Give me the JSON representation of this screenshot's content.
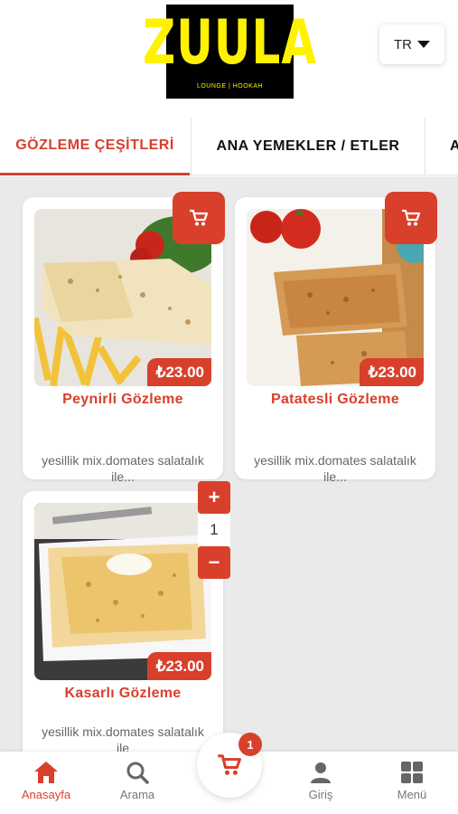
{
  "header": {
    "logo_text": "ZUULA",
    "logo_subtitle": "LOUNGE | HOOKAH",
    "language": "TR"
  },
  "tabs": [
    {
      "label": "GÖZLEME ÇEŞİTLERİ",
      "active": true
    },
    {
      "label": "ANA YEMEKLER / ETLER",
      "active": false
    },
    {
      "label": "A",
      "active": false
    }
  ],
  "products": [
    {
      "name": "Peynirli Gözleme",
      "price": "₺23.00",
      "description": "yesillik mix.domates salatalık ile...",
      "image_icon": "gozleme-fries-plate"
    },
    {
      "name": "Patatesli Gözleme",
      "price": "₺23.00",
      "description": "yesillik mix.domates salatalık ile...",
      "image_icon": "gozleme-board"
    },
    {
      "name": "Kasarlı Gözleme",
      "price": "₺23.00",
      "description": "yesillik mix.domates salatalık ile",
      "image_icon": "gozleme-cheese-plate",
      "quantity": "1"
    }
  ],
  "stepper": {
    "plus": "+",
    "minus": "−"
  },
  "bottom_nav": {
    "items": [
      {
        "label": "Anasayfa",
        "icon": "home-icon",
        "active": true
      },
      {
        "label": "Arama",
        "icon": "search-icon",
        "active": false
      },
      {
        "label": "Giriş",
        "icon": "user-icon",
        "active": false
      },
      {
        "label": "Menü",
        "icon": "grid-icon",
        "active": false
      }
    ],
    "cart_count": "1"
  },
  "colors": {
    "accent": "#d8402c",
    "logo_bg": "#000000",
    "logo_fg": "#fff200",
    "content_bg": "#eaeaea"
  }
}
